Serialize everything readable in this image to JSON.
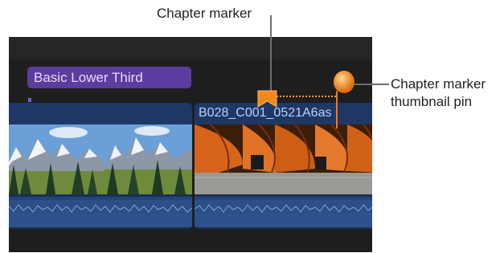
{
  "callouts": {
    "chapter_marker": "Chapter marker",
    "thumbnail_pin_line1": "Chapter marker",
    "thumbnail_pin_line2": "thumbnail pin"
  },
  "timeline": {
    "title_clip_label": "Basic Lower Third",
    "clips": [
      {
        "name": "",
        "type": "mountain-landscape"
      },
      {
        "name": "B028_C001_0521A6as",
        "type": "orange-tunnel"
      }
    ]
  },
  "colors": {
    "background": "#1e1e1f",
    "title_clip": "#5b3c9f",
    "video_clip": "#1f3766",
    "audio_track": "#2b4f86",
    "marker": "#f08a1c"
  }
}
